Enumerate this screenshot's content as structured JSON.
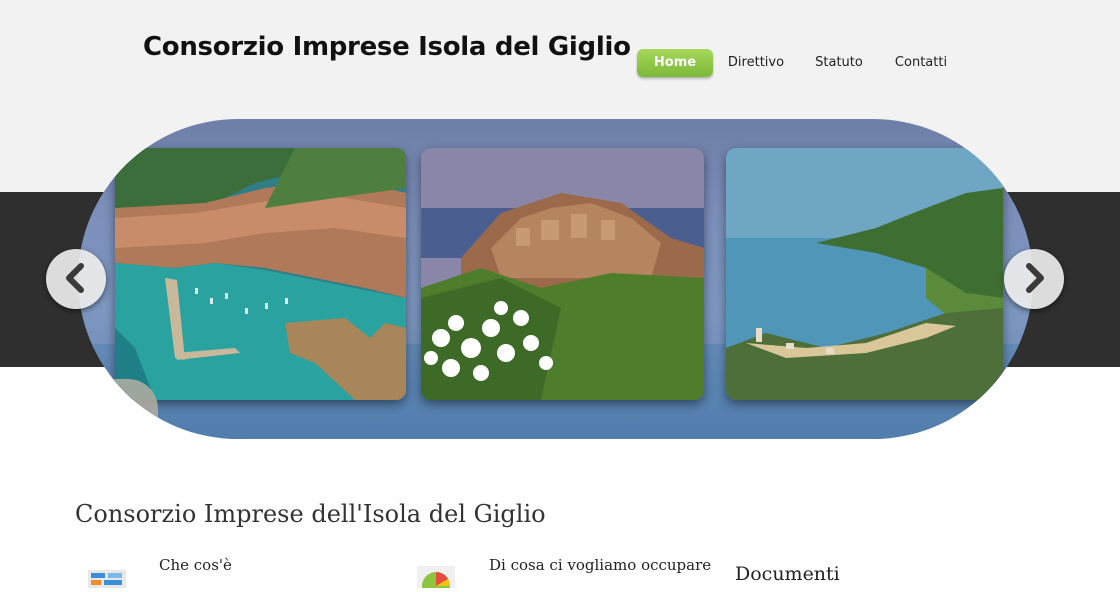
{
  "header": {
    "site_title": "Consorzio Imprese Isola del Giglio"
  },
  "nav": {
    "items": [
      {
        "label": "Home",
        "active": true
      },
      {
        "label": "Direttivo",
        "active": false
      },
      {
        "label": "Statuto",
        "active": false
      },
      {
        "label": "Contatti",
        "active": false
      }
    ],
    "accent_color": "#8cc63f"
  },
  "carousel": {
    "slides": [
      {
        "subject": "harbour-aerial-photo"
      },
      {
        "subject": "hilltop-village-photo"
      },
      {
        "subject": "bay-coastline-photo"
      }
    ],
    "prev_icon": "chevron-left-icon",
    "next_icon": "chevron-right-icon"
  },
  "main": {
    "section_title": "Consorzio Imprese dell'Isola del Giglio",
    "columns": [
      {
        "title": "Che cos'è",
        "icon": "info-board-icon"
      },
      {
        "title": "Di cosa ci vogliamo occupare",
        "icon": "pie-chart-icon"
      }
    ],
    "documents_title": "Documenti"
  }
}
